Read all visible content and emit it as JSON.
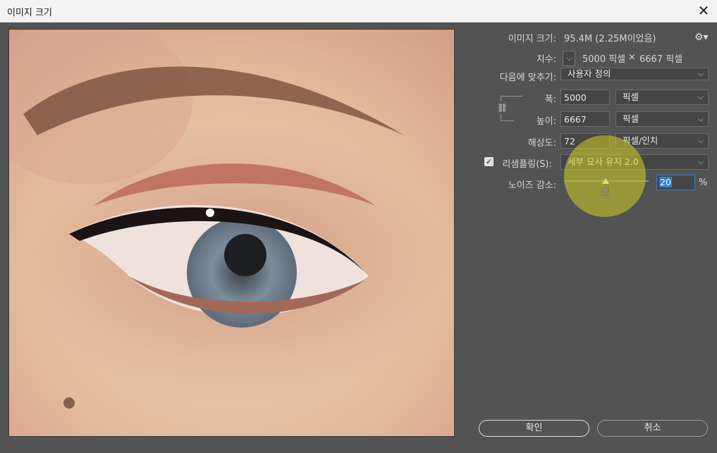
{
  "window": {
    "title": "이미지 크기",
    "close_glyph": "✕"
  },
  "image_size": {
    "label": "이미지 크기:",
    "value": "95.4M (2.25M이었음)"
  },
  "dimensions": {
    "label": "치수:",
    "width": "5000 픽셀",
    "times": "×",
    "height": "6667 픽셀"
  },
  "fit_to": {
    "label": "다음에 맞추기:",
    "value": "사용자 정의"
  },
  "width": {
    "label": "폭:",
    "value": "5000",
    "unit": "픽셀"
  },
  "height": {
    "label": "높이:",
    "value": "6667",
    "unit": "픽셀"
  },
  "resolution": {
    "label": "해상도:",
    "value": "72",
    "unit": "픽셀/인치"
  },
  "resample": {
    "label": "리샘플링(S):",
    "checked": true,
    "value": "세부 묘사 유지 2.0"
  },
  "noise": {
    "label": "노이즈 감소:",
    "value": "20",
    "unit": "%",
    "slider_level_percent": 20
  },
  "buttons": {
    "ok": "확인",
    "cancel": "취소"
  },
  "icons": {
    "gear": "gear-icon",
    "chain": "chain-link-icon",
    "dropdown": "chevron-down-icon"
  },
  "colors": {
    "background": "#535353",
    "titlebar": "#f3f3f3",
    "highlight": "#d2d228"
  }
}
